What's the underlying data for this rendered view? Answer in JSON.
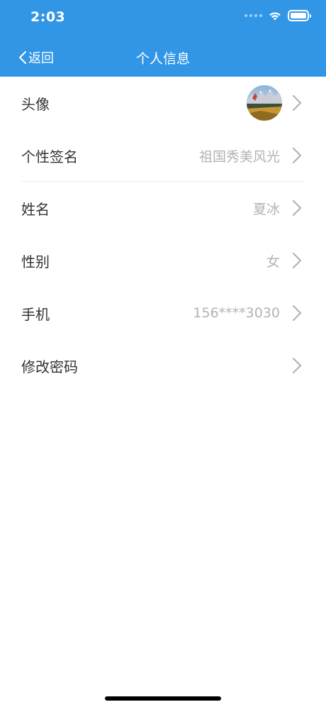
{
  "status_bar": {
    "time": "2:03"
  },
  "nav": {
    "back_label": "返回",
    "title": "个人信息"
  },
  "rows": [
    {
      "label": "头像",
      "value": ""
    },
    {
      "label": "个性签名",
      "value": "祖国秀美风光"
    },
    {
      "label": "姓名",
      "value": "夏冰"
    },
    {
      "label": "性别",
      "value": "女"
    },
    {
      "label": "手机",
      "value": "156****3030"
    },
    {
      "label": "修改密码",
      "value": ""
    }
  ],
  "colors": {
    "header": "#3296e6",
    "label": "#333333",
    "value": "#b3b3b3",
    "chevron": "#b3b3b3"
  },
  "icons": {
    "back": "chevron-left-icon",
    "row_arrow": "chevron-right-icon",
    "wifi": "wifi-icon",
    "battery": "battery-icon"
  }
}
